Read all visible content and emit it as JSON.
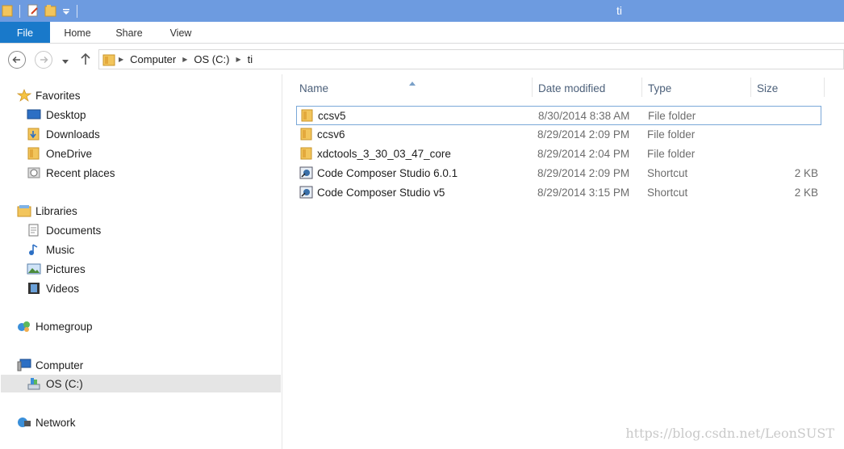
{
  "window": {
    "title": "ti"
  },
  "ribbon": {
    "tabs": [
      "File",
      "Home",
      "Share",
      "View"
    ]
  },
  "address": {
    "crumbs": [
      "Computer",
      "OS (C:)",
      "ti"
    ]
  },
  "nav": {
    "favorites": {
      "label": "Favorites",
      "items": [
        "Desktop",
        "Downloads",
        "OneDrive",
        "Recent places"
      ]
    },
    "libraries": {
      "label": "Libraries",
      "items": [
        "Documents",
        "Music",
        "Pictures",
        "Videos"
      ]
    },
    "homegroup": {
      "label": "Homegroup"
    },
    "computer": {
      "label": "Computer",
      "items": [
        "OS (C:)"
      ]
    },
    "network": {
      "label": "Network"
    }
  },
  "columns": {
    "name": "Name",
    "date": "Date modified",
    "type": "Type",
    "size": "Size"
  },
  "files": [
    {
      "name": "ccsv5",
      "date": "8/30/2014 8:38 AM",
      "type": "File folder",
      "size": "",
      "icon": "folder-icon"
    },
    {
      "name": "ccsv6",
      "date": "8/29/2014 2:09 PM",
      "type": "File folder",
      "size": "",
      "icon": "folder-icon"
    },
    {
      "name": "xdctools_3_30_03_47_core",
      "date": "8/29/2014 2:04 PM",
      "type": "File folder",
      "size": "",
      "icon": "folder-icon"
    },
    {
      "name": "Code Composer Studio 6.0.1",
      "date": "8/29/2014 2:09 PM",
      "type": "Shortcut",
      "size": "2 KB",
      "icon": "shortcut-icon"
    },
    {
      "name": "Code Composer Studio v5",
      "date": "8/29/2014 3:15 PM",
      "type": "Shortcut",
      "size": "2 KB",
      "icon": "shortcut-icon"
    }
  ],
  "watermark": "https://blog.csdn.net/LeonSUST",
  "colors": {
    "titlebar": "#6d9be0",
    "file_tab": "#1979ca",
    "folder": "#e8b84a",
    "selection_border": "#7aa8d8"
  }
}
